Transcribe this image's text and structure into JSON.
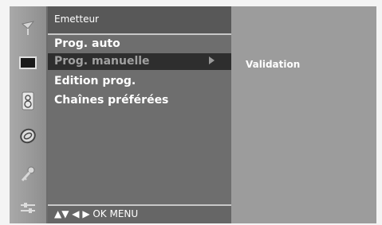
{
  "icons": [
    {
      "name": "antenna-icon"
    },
    {
      "name": "picture-icon"
    },
    {
      "name": "speaker-icon"
    },
    {
      "name": "clock-icon"
    },
    {
      "name": "key-icon"
    },
    {
      "name": "setup-icon"
    }
  ],
  "menu": {
    "title": "Emetteur",
    "items": [
      {
        "label": "Prog. auto",
        "selected": false
      },
      {
        "label": "Prog. manuelle",
        "selected": true
      },
      {
        "label": "Edition prog.",
        "selected": false
      },
      {
        "label": "Chaînes préférées",
        "selected": false
      }
    ],
    "footer": "▲▼  ◀ ▶  OK  MENU"
  },
  "submenu": {
    "label": "Validation"
  },
  "colors": {
    "menu_bg": "#6e6e6e",
    "selected_bg": "#2e2e2e",
    "panel_bg": "#9c9c9c"
  }
}
